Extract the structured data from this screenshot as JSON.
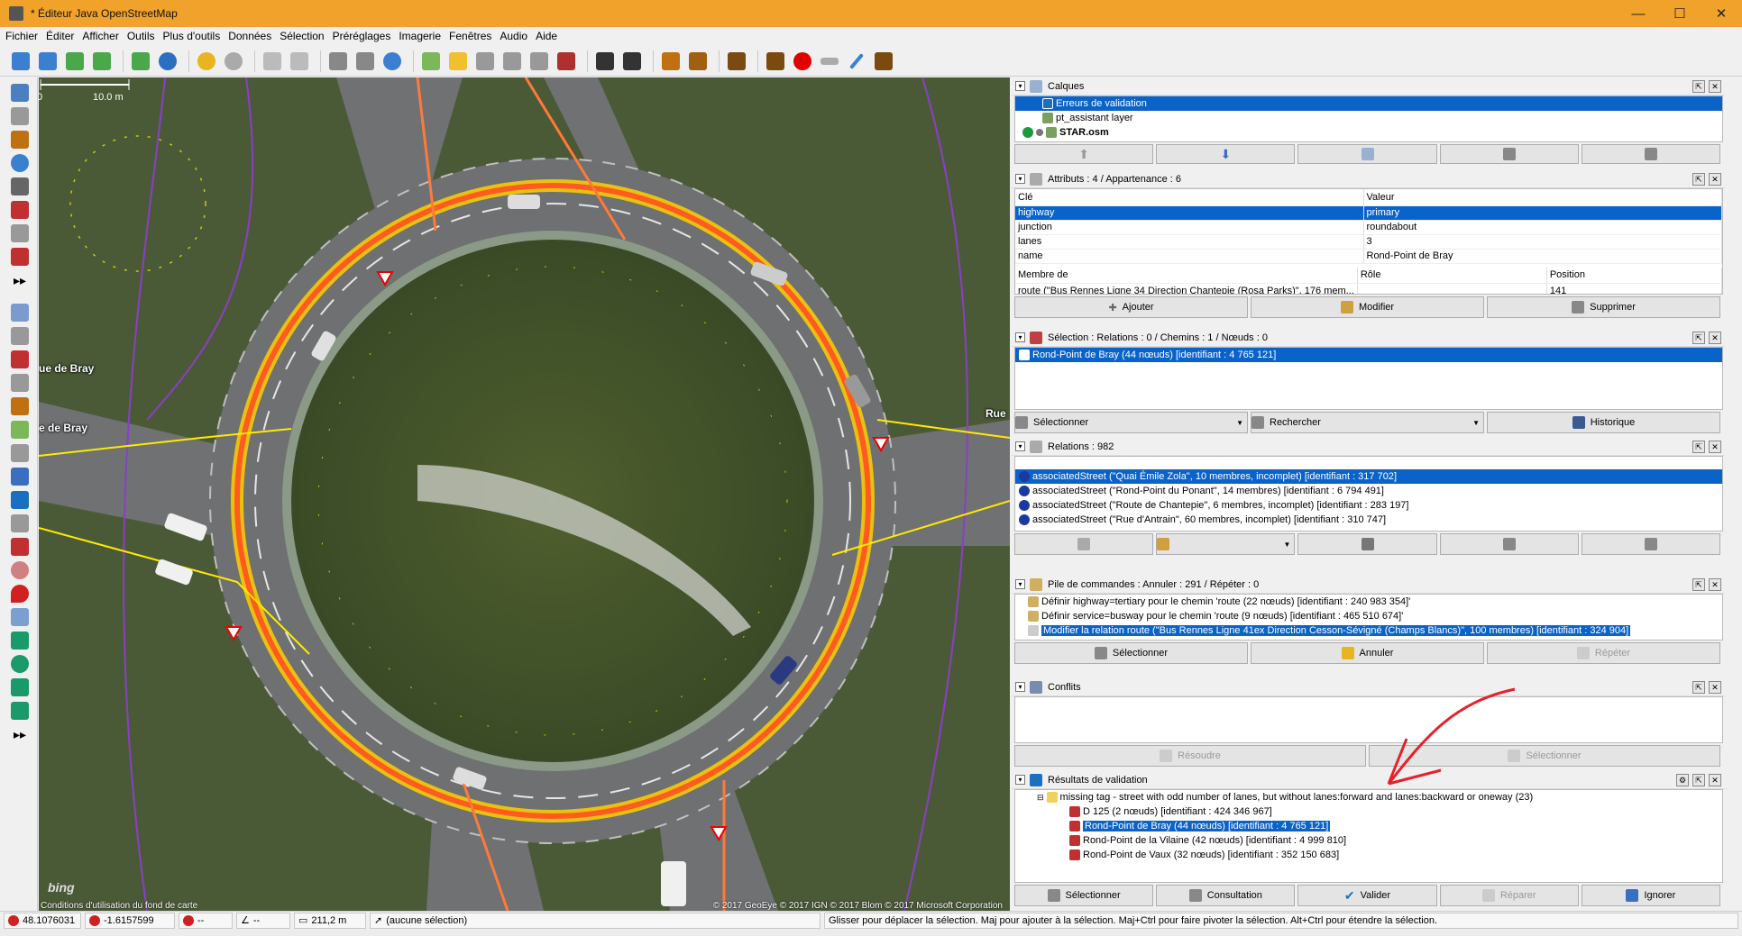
{
  "window": {
    "title": "* Éditeur Java OpenStreetMap",
    "minimize": "—",
    "maximize": "☐",
    "close": "✕"
  },
  "menu": [
    "Fichier",
    "Éditer",
    "Afficher",
    "Outils",
    "Plus d'outils",
    "Données",
    "Sélection",
    "Préréglages",
    "Imagerie",
    "Fenêtres",
    "Audio",
    "Aide"
  ],
  "map": {
    "scale_label": "10.0 m",
    "scale_zero": "0",
    "streets": [
      "ue de Bray",
      "e de Bray",
      "Rue"
    ],
    "attribution": "Conditions d'utilisation du fond de carte",
    "copyright": "© 2017 GeoEye © 2017 IGN © 2017 Blom © 2017 Microsoft Corporation",
    "bing": "bing"
  },
  "panels": {
    "layers": {
      "title": "Calques",
      "items": [
        {
          "name": "Erreurs de validation",
          "selected": true
        },
        {
          "name": "pt_assistant layer",
          "selected": false
        },
        {
          "name": "STAR.osm",
          "selected": false
        }
      ]
    },
    "attributes": {
      "title": "Attributs : 4 / Appartenance : 6",
      "col_key": "Clé",
      "col_value": "Valeur",
      "rows": [
        {
          "k": "highway",
          "v": "primary",
          "selected": true
        },
        {
          "k": "junction",
          "v": "roundabout",
          "selected": false
        },
        {
          "k": "lanes",
          "v": "3",
          "selected": false
        },
        {
          "k": "name",
          "v": "Rond-Point de Bray",
          "selected": false
        }
      ],
      "mem_col1": "Membre de",
      "mem_col2": "Rôle",
      "mem_col3": "Position",
      "mem_row": {
        "member": "route (\"Bus Rennes Ligne 34 Direction Chantepie (Rosa Parks)\", 176 mem...",
        "role": "",
        "pos": "141"
      },
      "buttons": [
        "Ajouter",
        "Modifier",
        "Supprimer"
      ]
    },
    "selection": {
      "title": "Sélection : Relations : 0 / Chemins : 1 / Nœuds : 0",
      "item": "Rond-Point de Bray (44 nœuds) [identifiant : 4 765 121]",
      "buttons": [
        "Sélectionner",
        "Rechercher",
        "Historique"
      ]
    },
    "relations": {
      "title": "Relations : 982",
      "items": [
        {
          "text": "associatedStreet (\"Quai Émile Zola\", 10 membres, incomplet) [identifiant : 317 702]",
          "selected": true
        },
        {
          "text": "associatedStreet (\"Rond-Point du Ponant\", 14 membres) [identifiant : 6 794 491]",
          "selected": false
        },
        {
          "text": "associatedStreet (\"Route de Chantepie\", 6 membres, incomplet) [identifiant : 283 197]",
          "selected": false
        },
        {
          "text": "associatedStreet (\"Rue d'Antrain\", 60 membres, incomplet) [identifiant : 310 747]",
          "selected": false
        }
      ]
    },
    "commands": {
      "title": "Pile de commandes : Annuler : 291 / Répéter : 0",
      "items": [
        {
          "text": "Définir highway=tertiary pour le chemin 'route (22 nœuds) [identifiant : 240 983 354]'",
          "selected": false
        },
        {
          "text": "Définir service=busway pour le chemin 'route (9 nœuds) [identifiant : 465 510 674]'",
          "selected": false
        },
        {
          "text": "Modifier la relation route (\"Bus Rennes Ligne 41ex Direction Cesson-Sévigné (Champs Blancs)\", 100 membres) [identifiant : 324 904]",
          "selected": true
        }
      ],
      "buttons": [
        "Sélectionner",
        "Annuler",
        "Répéter"
      ]
    },
    "conflicts": {
      "title": "Conflits",
      "buttons": [
        "Résoudre",
        "Sélectionner"
      ]
    },
    "validation": {
      "title": "Résultats de validation",
      "group": "missing tag - street with odd number of lanes, but without lanes:forward and lanes:backward or oneway (23)",
      "items": [
        {
          "text": "D 125 (2 nœuds) [identifiant : 424 346 967]",
          "selected": false
        },
        {
          "text": "Rond-Point de Bray (44 nœuds) [identifiant : 4 765 121]",
          "selected": true
        },
        {
          "text": "Rond-Point de la Vilaine (42 nœuds) [identifiant : 4 999 810]",
          "selected": false
        },
        {
          "text": "Rond-Point de Vaux (32 nœuds) [identifiant : 352 150 683]",
          "selected": false
        }
      ],
      "buttons": [
        "Sélectionner",
        "Consultation",
        "Valider",
        "Réparer",
        "Ignorer"
      ]
    }
  },
  "status": {
    "lat": "48.1076031",
    "lon": "-1.6157599",
    "heading": "--",
    "angle": "--",
    "distance": "211,2 m",
    "selection": "(aucune sélection)",
    "hint": "Glisser pour déplacer la sélection. Maj pour ajouter à la sélection. Maj+Ctrl pour faire pivoter la sélection. Alt+Ctrl pour étendre la sélection."
  },
  "colors": {
    "titlebar": "#f0a22b",
    "selection": "#0a63c9",
    "way_highlight": "#ff5a1f",
    "way_glow": "#ffd000",
    "arrow": "#e8202a"
  }
}
